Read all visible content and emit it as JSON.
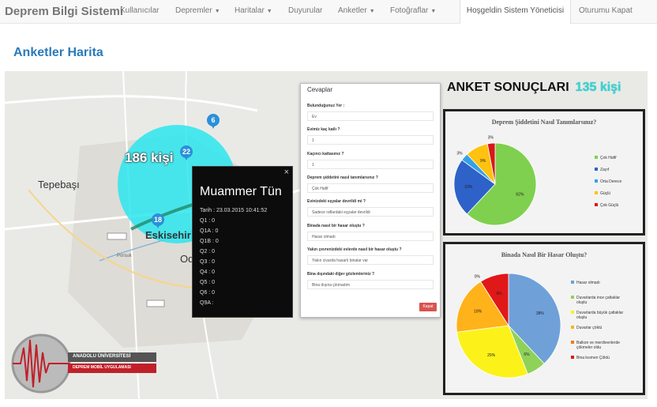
{
  "navbar": {
    "brand": "Deprem Bilgi Sistemi",
    "items": [
      {
        "label": "Kullanıcılar",
        "dropdown": false
      },
      {
        "label": "Depremler",
        "dropdown": true
      },
      {
        "label": "Haritalar",
        "dropdown": true
      },
      {
        "label": "Duyurular",
        "dropdown": false
      },
      {
        "label": "Anketler",
        "dropdown": true
      },
      {
        "label": "Fotoğraflar",
        "dropdown": true
      }
    ],
    "welcome": "Hoşgeldin Sistem Yöneticisi",
    "logout": "Oturumu Kapat",
    "caret": "▼"
  },
  "page": {
    "title": "Anketler Harita"
  },
  "map": {
    "places": [
      "Tepebaşı",
      "Eskisehir",
      "Od"
    ],
    "circle_label": "186 kişi",
    "markers": [
      "6",
      "22",
      "18"
    ],
    "logo_line1": "ANADOLU ÜNİVERSİTESİ",
    "logo_line2": "DEPREM MOBİL UYGULAMASI",
    "colors": {
      "circle": "#2ce6ee",
      "marker": "#2a90d8"
    }
  },
  "popup": {
    "close": "×",
    "name": "Muammer Tün",
    "rows": [
      "Tarih : 23.03.2015 10:41:52",
      "Q1 : 0",
      "Q1A : 0",
      "Q1B : 0",
      "Q2 : 0",
      "Q3 : 0",
      "Q4 : 0",
      "Q5 : 0",
      "Q6 : 0",
      "Q9A :"
    ]
  },
  "answers": {
    "title": "Cevaplar",
    "items": [
      {
        "q": "Bulunduğunuz Yer :",
        "a": "Ev"
      },
      {
        "q": "Evimiz kaç katlı ?",
        "a": "1"
      },
      {
        "q": "Kaçıncı kattasınız ?",
        "a": "1"
      },
      {
        "q": "Deprem şiddetini nasıl tanımlarsınız ?",
        "a": "Çok Hafif"
      },
      {
        "q": "Evinizdeki eşyalar devrildi mi ?",
        "a": "Sadece raflardaki eşyalar devrildi"
      },
      {
        "q": "Binada nasıl bir hasar oluştu ?",
        "a": "Hasar olmadı"
      },
      {
        "q": "Yakın çevrenizdeki evlerde nasıl bir hasar oluştu ?",
        "a": "Yakın civarda hasarlı binalar var"
      },
      {
        "q": "Bina dışındaki diğer gözlemleriniz ?",
        "a": "Bina dışına çıkmadım"
      }
    ],
    "close_button": "Kapat"
  },
  "survey": {
    "title": "ANKET SONUÇLARI",
    "count": "135 kişi"
  },
  "chart_data": [
    {
      "type": "pie",
      "title": "Deprem Şiddetini Nasıl Tanımlarsınız?",
      "categories": [
        "Çok Hafif",
        "Zayıf",
        "Orta Derece",
        "Güçlü",
        "Çok Güçlü"
      ],
      "values": [
        62,
        23,
        3,
        9,
        3
      ],
      "labels": [
        "62%",
        "23%",
        "3%",
        "9%",
        "3%"
      ],
      "colors": [
        "#7fd04e",
        "#2e62c8",
        "#35a0e8",
        "#ffc20f",
        "#d81818"
      ],
      "legend": "right"
    },
    {
      "type": "pie",
      "title": "Binada Nasıl Bir Hasar Oluştu?",
      "categories": [
        "Hasar olmadı",
        "Duvarlarda ince çatlaklar oluştu",
        "Duvarlarda büyük çatlaklar oluştu",
        "Duvarlar çöktü",
        "Balkon ve merdivenlerde çökmeler oldu",
        "Bina kısmen Çöktü"
      ],
      "values": [
        38,
        6,
        29,
        18,
        0,
        9
      ],
      "labels": [
        "38%",
        "6%",
        "29%",
        "18%",
        "0%",
        "9%"
      ],
      "colors": [
        "#6fa0d8",
        "#8ed25a",
        "#fcf21a",
        "#ffb21a",
        "#f07a1a",
        "#e01818"
      ],
      "legend": "right"
    }
  ]
}
